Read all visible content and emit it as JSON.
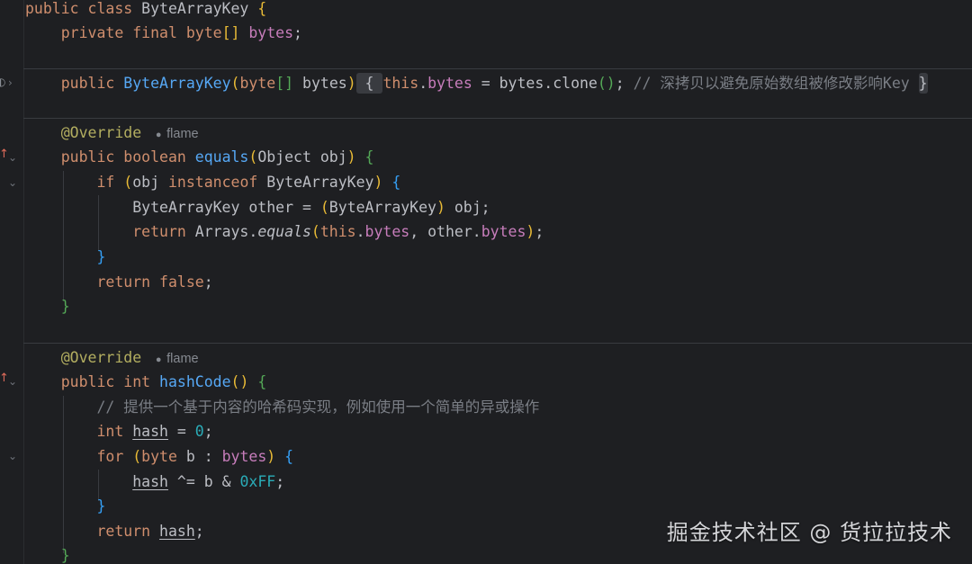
{
  "code": {
    "l1": {
      "kw": "public class ",
      "type": "ByteArrayKey",
      "brace": "{"
    },
    "l2": {
      "kw": "private final byte",
      "br": "[]",
      "field": "bytes",
      "semi": ";"
    },
    "l3": {
      "kw": "public ",
      "fn": "ByteArrayKey",
      "p1": "(",
      "ptype": "byte",
      "pbr": "[]",
      "pname": " bytes",
      "p2": ")",
      "fold_open": " { ",
      "this": "this",
      "dot1": ".",
      "field": "bytes",
      "assign": " = bytes.clone",
      "call": "()",
      "semi": ";",
      "comment": " // 深拷贝以避免原始数组被修改影响Key ",
      "fold_close": "}"
    },
    "l4": {
      "annotation": "@Override",
      "author": "flame"
    },
    "l5": {
      "kw": "public boolean ",
      "fn": "equals",
      "p1": "(",
      "params": "Object obj",
      "p2": ")",
      "brace": " {"
    },
    "l6": {
      "kw": "if ",
      "p1": "(",
      "obj": "obj ",
      "kw2": "instanceof ",
      "type": "ByteArrayKey",
      "p2": ")",
      "brace": " {"
    },
    "l7": {
      "decl": "ByteArrayKey other = ",
      "p1": "(",
      "type": "ByteArrayKey",
      "p2": ")",
      "rest": " obj;"
    },
    "l8": {
      "kw": "return ",
      "cls": "Arrays.",
      "fn": "equals",
      "p1": "(",
      "this": "this",
      "dot": ".",
      "f1": "bytes",
      "mid": ", other.",
      "f2": "bytes",
      "p2": ")",
      "semi": ";"
    },
    "l9": {
      "brace": "}"
    },
    "l10": {
      "kw": "return false",
      "semi": ";"
    },
    "l11": {
      "brace": "}"
    },
    "l12": {
      "annotation": "@Override",
      "author": "flame"
    },
    "l13": {
      "kw": "public int ",
      "fn": "hashCode",
      "p1": "()",
      "brace": " {"
    },
    "l14": {
      "comment": "// 提供一个基于内容的哈希码实现，例如使用一个简单的异或操作"
    },
    "l15": {
      "kw": "int ",
      "var": "hash",
      "eq": " = ",
      "num": "0",
      "semi": ";"
    },
    "l16": {
      "kw": "for ",
      "p1": "(",
      "kw2": "byte ",
      "mid": "b : ",
      "field": "bytes",
      "p2": ")",
      "brace": " {"
    },
    "l17": {
      "var": "hash",
      "mid": " ^= b & ",
      "num": "0xFF",
      "semi": ";"
    },
    "l18": {
      "brace": "}"
    },
    "l19": {
      "kw": "return ",
      "var": "hash",
      "semi": ";"
    },
    "l20": {
      "brace": "}"
    }
  },
  "gutter": {
    "override_icon": "override-arrow-icon",
    "chevron_icon": "chevron-down-icon"
  },
  "watermark": "掘金技术社区 @ 货拉拉技术",
  "colors": {
    "background": "#1e1f22",
    "keyword": "#cf8e6d",
    "function": "#56a8f5",
    "field": "#c77dbb",
    "annotation": "#b3ae60",
    "number": "#2aacb8",
    "comment": "#7a7e85"
  }
}
